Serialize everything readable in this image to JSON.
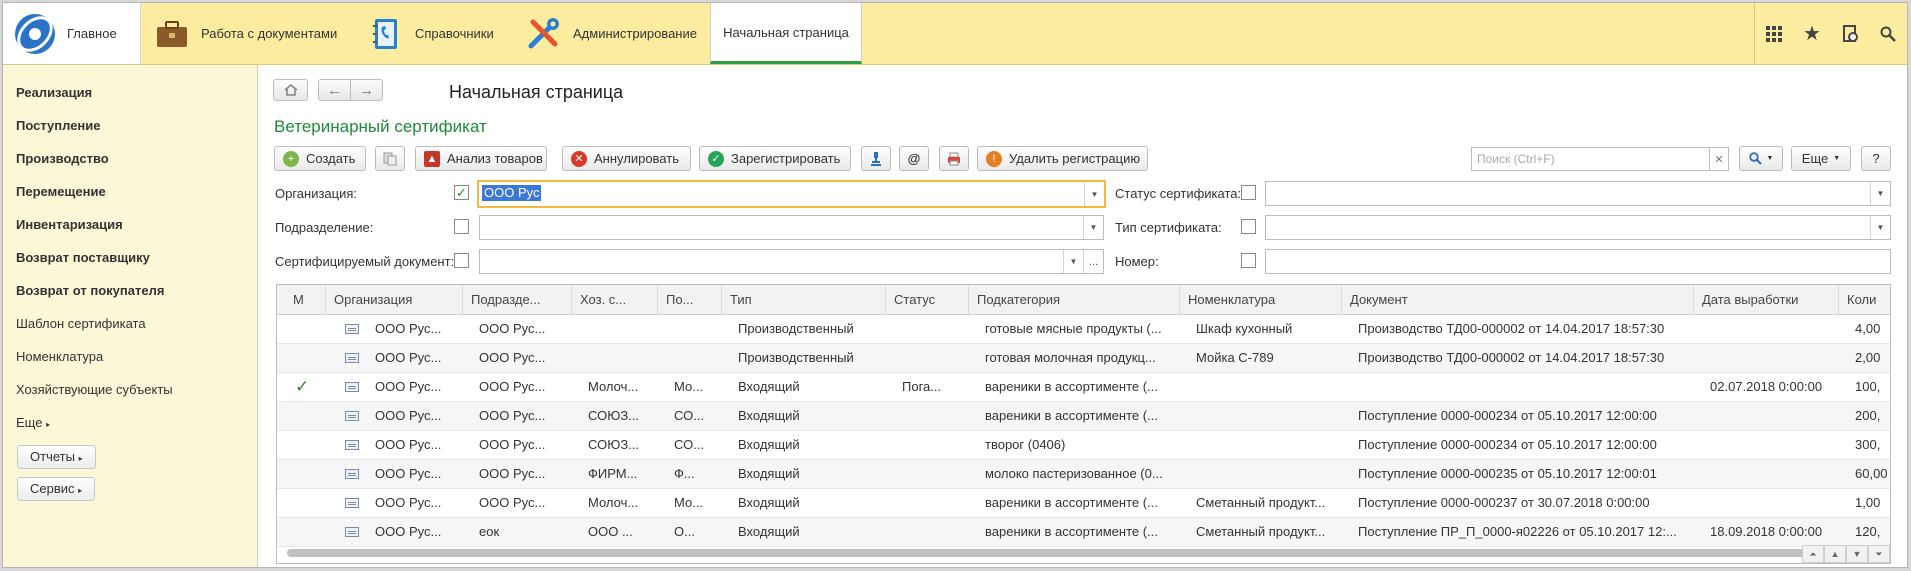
{
  "top_sections": {
    "main": "Главное",
    "documents": "Работа с документами",
    "references": "Справочники",
    "admin": "Администрирование",
    "active_tab": "Начальная страница"
  },
  "sidebar": {
    "bold_items": [
      "Реализация",
      "Поступление",
      "Производство",
      "Перемещение",
      "Инвентаризация",
      "Возврат поставщику",
      "Возврат от покупателя"
    ],
    "items": [
      "Шаблон сертификата",
      "Номенклатура",
      "Хозяйствующие субъекты"
    ],
    "more": "Еще",
    "reports_btn": "Отчеты",
    "service_btn": "Сервис"
  },
  "page_title": "Начальная страница",
  "form_title": "Ветеринарный сертификат",
  "toolbar": {
    "create": "Создать",
    "analyze": "Анализ товаров",
    "cancel": "Аннулировать",
    "register": "Зарегистрировать",
    "at": "@",
    "delete_reg": "Удалить регистрацию",
    "search_placeholder": "Поиск (Ctrl+F)",
    "more": "Еще",
    "help": "?"
  },
  "filters": {
    "org_label": "Организация:",
    "org_value": "ООО Рус",
    "subdiv_label": "Подразделение:",
    "doc_label": "Сертифицируемый документ:",
    "doc_extra": "...",
    "status_label": "Статус сертификата:",
    "type_label": "Тип сертификата:",
    "number_label": "Номер:"
  },
  "table": {
    "columns": [
      "М",
      "Организация",
      "Подразде...",
      "Хоз. с...",
      "По...",
      "Тип",
      "Статус",
      "Подкатегория",
      "Номенклатура",
      "Документ",
      "Дата выработки",
      "Коли"
    ],
    "rows": [
      {
        "m": "",
        "org": "ООО Рус...",
        "sub": "ООО Рус...",
        "hoz": "",
        "po": "",
        "type": "Производственный",
        "status": "",
        "subcat": "готовые мясные продукты (...",
        "nom": "Шкаф кухонный",
        "doc": "Производство ТД00-000002 от 14.04.2017 18:57:30",
        "date": "",
        "qty": "4,00"
      },
      {
        "m": "",
        "org": "ООО Рус...",
        "sub": "ООО Рус...",
        "hoz": "",
        "po": "",
        "type": "Производственный",
        "status": "",
        "subcat": "готовая молочная продукц...",
        "nom": "Мойка С-789",
        "doc": "Производство ТД00-000002 от 14.04.2017 18:57:30",
        "date": "",
        "qty": "2,00"
      },
      {
        "m": "✓",
        "org": "ООО Рус...",
        "sub": "ООО Рус...",
        "hoz": "Молоч...",
        "po": "Мо...",
        "type": "Входящий",
        "status": "Пога...",
        "subcat": "вареники в ассортименте (...",
        "nom": "",
        "doc": "",
        "date": "02.07.2018 0:00:00",
        "qty": "100,"
      },
      {
        "m": "",
        "org": "ООО Рус...",
        "sub": "ООО Рус...",
        "hoz": "СОЮЗ...",
        "po": "СО...",
        "type": "Входящий",
        "status": "",
        "subcat": "вареники в ассортименте (...",
        "nom": "",
        "doc": "Поступление 0000-000234 от 05.10.2017 12:00:00",
        "date": "",
        "qty": "200,"
      },
      {
        "m": "",
        "org": "ООО Рус...",
        "sub": "ООО Рус...",
        "hoz": "СОЮЗ...",
        "po": "СО...",
        "type": "Входящий",
        "status": "",
        "subcat": "творог (0406)",
        "nom": "",
        "doc": "Поступление 0000-000234 от 05.10.2017 12:00:00",
        "date": "",
        "qty": "300,"
      },
      {
        "m": "",
        "org": "ООО Рус...",
        "sub": "ООО Рус...",
        "hoz": "ФИРМ...",
        "po": "Ф...",
        "type": "Входящий",
        "status": "",
        "subcat": "молоко пастеризованное (0...",
        "nom": "",
        "doc": "Поступление 0000-000235 от 05.10.2017 12:00:01",
        "date": "",
        "qty": "60,00"
      },
      {
        "m": "",
        "org": "ООО Рус...",
        "sub": "ООО Рус...",
        "hoz": "Молоч...",
        "po": "Мо...",
        "type": "Входящий",
        "status": "",
        "subcat": "вареники в ассортименте (...",
        "nom": "Сметанный продукт...",
        "doc": "Поступление 0000-000237 от 30.07.2018 0:00:00",
        "date": "",
        "qty": "1,00"
      },
      {
        "m": "",
        "org": "ООО Рус...",
        "sub": "еок",
        "hoz": "ООО ...",
        "po": "О...",
        "type": "Входящий",
        "status": "",
        "subcat": "вареники в ассортименте (...",
        "nom": "Сметанный продукт...",
        "doc": "Поступление ПР_П_0000-я02226 от 05.10.2017 12:...",
        "date": "18.09.2018 0:00:00",
        "qty": "120,"
      }
    ]
  },
  "colors": {
    "topbar": "#fbeca0",
    "sidebar": "#fcf7d6",
    "accent_green": "#1e8a3a",
    "focus": "#f4b93c"
  }
}
